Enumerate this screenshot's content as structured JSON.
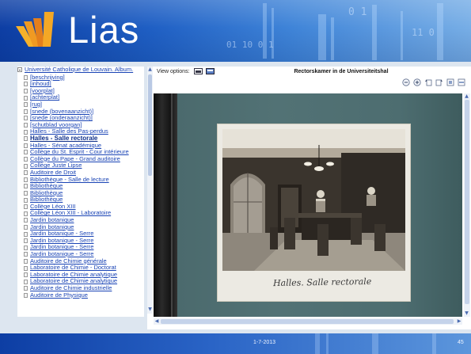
{
  "app": {
    "logo_text": "Lias"
  },
  "tree": {
    "root_label": "Université Catholique de Louvain. Album.",
    "items": [
      {
        "label": "[beschrijving]"
      },
      {
        "label": "[inhoud]"
      },
      {
        "label": "[voorplat]"
      },
      {
        "label": "[achterplat]"
      },
      {
        "label": "[rug]"
      },
      {
        "label": "[snede (bovenaanzicht)]"
      },
      {
        "label": "[snede (onderaanzicht)]"
      },
      {
        "label": "[schutblad voorgan]"
      },
      {
        "label": "Halles - Salle des Pas-perdus"
      },
      {
        "label": "Halles - Salle rectorale",
        "current": true
      },
      {
        "label": "Halles - Sénat académique"
      },
      {
        "label": "Collège du St. Esprit - Cour intérieure"
      },
      {
        "label": "Collège du Pape - Grand auditoire"
      },
      {
        "label": "Collège Juste Lipse"
      },
      {
        "label": "Auditoire de Droit"
      },
      {
        "label": "Bibliothèque - Salle de lecture"
      },
      {
        "label": "Bibliothèque"
      },
      {
        "label": "Bibliothèque"
      },
      {
        "label": "Bibliothèque"
      },
      {
        "label": "Collège Léon XIII"
      },
      {
        "label": "Collège Léon XIII - Laboratoire"
      },
      {
        "label": "Jardin botanique"
      },
      {
        "label": "Jardin botanique"
      },
      {
        "label": "Jardin botanique - Serre"
      },
      {
        "label": "Jardin botanique - Serre"
      },
      {
        "label": "Jardin botanique - Serre"
      },
      {
        "label": "Jardin botanique - Serre"
      },
      {
        "label": "Auditoire de Chimie générale"
      },
      {
        "label": "Laboratoire de Chimie - Doctorat"
      },
      {
        "label": "Laboratoire de Chimie analytique"
      },
      {
        "label": "Laboratoire de Chimie analytique"
      },
      {
        "label": "Auditoire de Chimie industrielle"
      },
      {
        "label": "Auditoire de Physique"
      }
    ]
  },
  "viewer": {
    "view_options_label": "View options:",
    "title": "Rectorskamer in de Universiteitshal",
    "caption": "Halles. Salle rectorale"
  },
  "footer": {
    "date": "1-7-2013",
    "page_number": "45"
  },
  "colors": {
    "brand_blue": "#1f5fc4",
    "link": "#1a44b5",
    "album_board": "#527275"
  }
}
